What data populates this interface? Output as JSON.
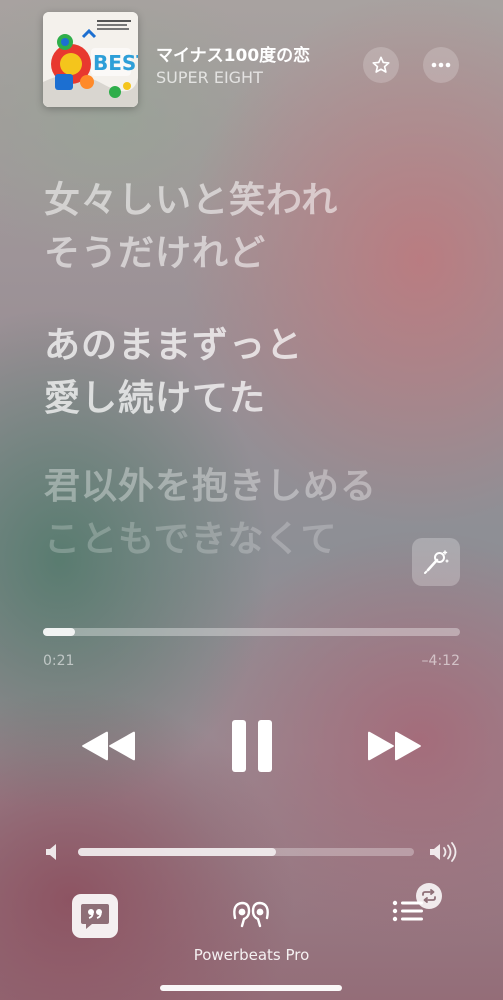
{
  "track": {
    "title": "マイナス100度の恋",
    "artist": "SUPER EIGHT"
  },
  "album_art": {
    "description_icon": "album-cover",
    "cover_text": "BEST",
    "colors": [
      "#e8382f",
      "#2fae4a",
      "#1c6fd1",
      "#f4c51c",
      "#ff8a2a"
    ]
  },
  "lyrics": {
    "lines": [
      "女々しいと笑われ",
      "そうだけれど",
      "あのままずっと",
      "愛し続けてた",
      "君以外を抱きしめる",
      "こともできなくて"
    ]
  },
  "playback": {
    "elapsed": "0:21",
    "remaining": "–4:12",
    "progress_fraction": 0.077,
    "state": "playing"
  },
  "volume": {
    "level_fraction": 0.59
  },
  "output": {
    "device_name": "Powerbeats Pro"
  },
  "icons": {
    "star": "star-icon",
    "more": "ellipsis-icon",
    "sing": "microphone-sparkle-icon",
    "rewind": "rewind-icon",
    "pause": "pause-icon",
    "forward": "fast-forward-icon",
    "volume_low": "speaker-low-icon",
    "volume_high": "speaker-high-icon",
    "lyrics": "quote-bubble-icon",
    "airplay": "earbuds-icon",
    "queue": "list-icon",
    "repeat": "repeat-icon"
  }
}
